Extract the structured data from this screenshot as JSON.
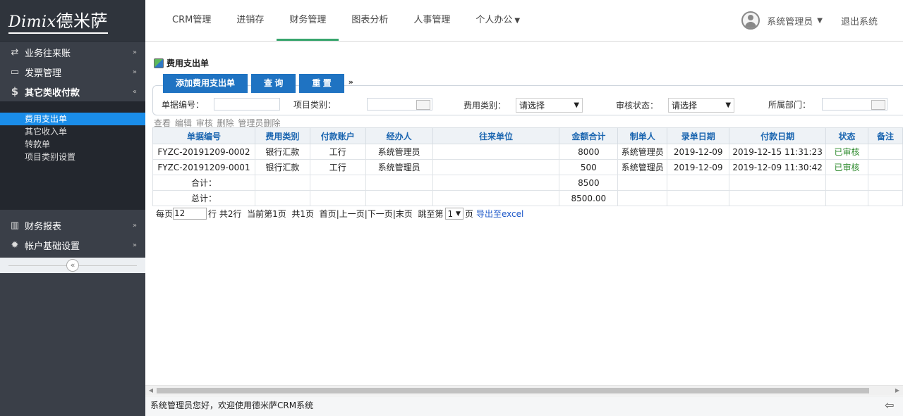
{
  "logo": {
    "en": "Dimix",
    "cn": "德米萨"
  },
  "sidebar": {
    "groups_top": [
      {
        "icon": "⇄",
        "label": "业务往来账",
        "chev": "»"
      },
      {
        "icon": "▭",
        "label": "发票管理",
        "chev": "»"
      },
      {
        "icon": "$",
        "label": "其它类收付款",
        "chev": "«"
      }
    ],
    "sub_items": [
      "费用支出单",
      "其它收入单",
      "转款单",
      "项目类别设置"
    ],
    "groups_bottom": [
      {
        "icon": "▥",
        "label": "财务报表",
        "chev": "»"
      },
      {
        "icon": "✹",
        "label": "帐户基础设置",
        "chev": "»"
      }
    ],
    "collapse": "«"
  },
  "topnav": {
    "items": [
      "CRM管理",
      "进销存",
      "财务管理",
      "图表分析",
      "人事管理",
      "个人办公"
    ],
    "dropdown_caret": "▼",
    "user": "系统管理员",
    "logout": "退出系统"
  },
  "page": {
    "title": "费用支出单",
    "buttons": {
      "add": "添加费用支出单",
      "query": "查 询",
      "reset": "重 置"
    },
    "expand": "»"
  },
  "search": {
    "bill_no_label": "单据编号：",
    "project_label": "项目类别：",
    "fee_type_label": "费用类别：",
    "fee_type_value": "请选择",
    "audit_label": "审核状态：",
    "audit_value": "请选择",
    "dept_label": "所属部门："
  },
  "actions": [
    "查看",
    "编辑",
    "审核",
    "删除",
    "管理员删除"
  ],
  "table": {
    "columns": [
      "单据编号",
      "费用类别",
      "付款账户",
      "经办人",
      "往来单位",
      "金额合计",
      "制单人",
      "录单日期",
      "付款日期",
      "状态",
      "备注"
    ],
    "rows": [
      [
        "FYZC-20191209-0002",
        "银行汇款",
        "工行",
        "系统管理员",
        "",
        "8000",
        "系统管理员",
        "2019-12-09",
        "2019-12-15 11:31:23",
        "已审核",
        ""
      ],
      [
        "FYZC-20191209-0001",
        "银行汇款",
        "工行",
        "系统管理员",
        "",
        "500",
        "系统管理员",
        "2019-12-09",
        "2019-12-09 11:30:42",
        "已审核",
        ""
      ]
    ],
    "subtotal_label": "合计：",
    "subtotal_value": "8500",
    "total_label": "总计：",
    "total_value": "8500.00"
  },
  "pager": {
    "per_page_label": "每页",
    "per_page_value": "12",
    "rows_text": "行 共2行",
    "current_text": "当前第1页",
    "pages_text": "共1页",
    "nav_first": "首页",
    "nav_prev": "上一页",
    "nav_next": "下一页",
    "nav_last": "末页",
    "jump_label": "跳至第",
    "jump_value": "1",
    "page_suffix": "页",
    "export": "导出至excel"
  },
  "statusbar": {
    "text": "系统管理员您好，欢迎使用德米萨CRM系统"
  }
}
